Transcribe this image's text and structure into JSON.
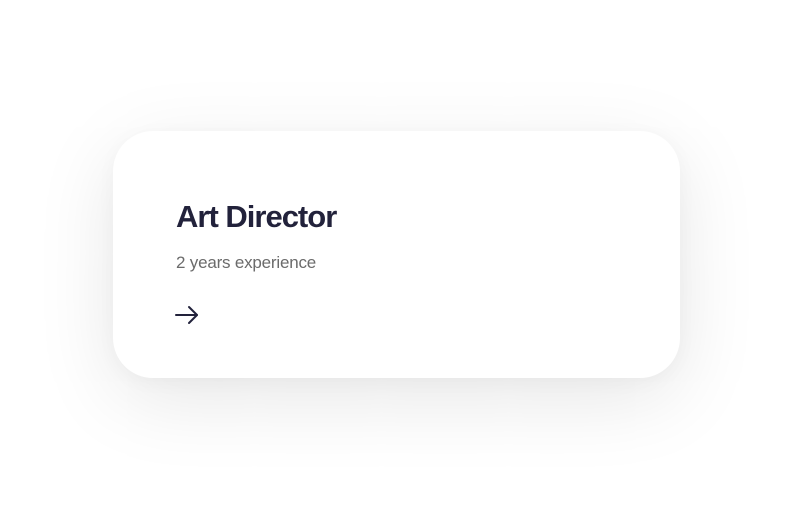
{
  "card": {
    "title": "Art Director",
    "subtitle": "2 years experience",
    "action_icon": "arrow-right-icon",
    "colors": {
      "title": "#22223b",
      "subtitle": "#6b6b6b",
      "background": "#ffffff"
    }
  }
}
